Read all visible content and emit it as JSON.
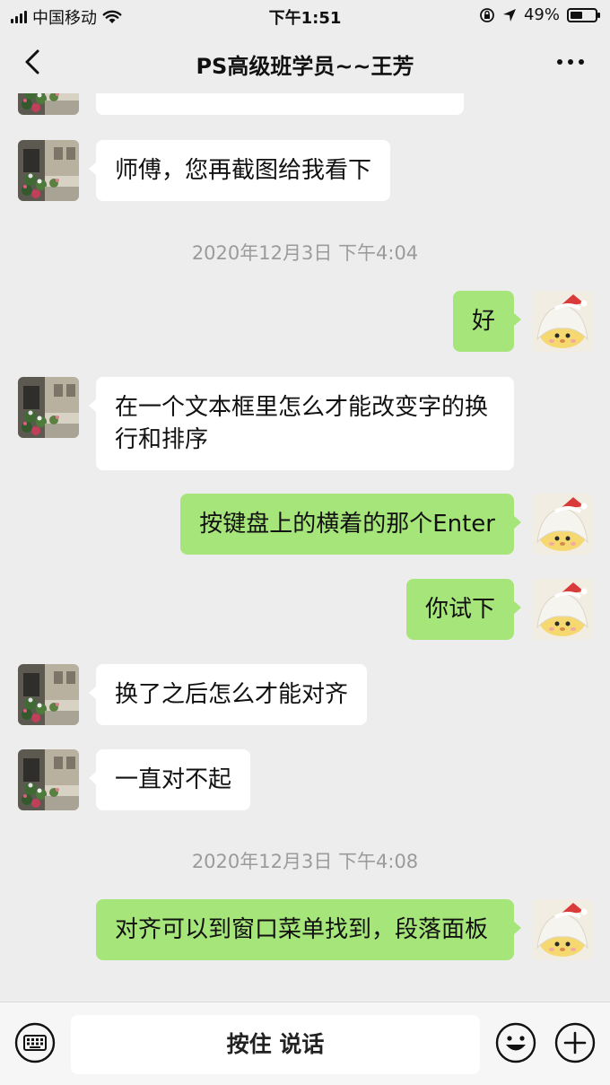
{
  "status_bar": {
    "carrier": "中国移动",
    "time": "下午1:51",
    "battery_text": "49%",
    "battery_level": 0.49
  },
  "nav": {
    "title": "PS高级班学员~~王芳"
  },
  "messages": [
    {
      "type": "in",
      "text": "师傅，您再截图给我看下"
    },
    {
      "type": "timestamp",
      "text": "2020年12月3日 下午4:04"
    },
    {
      "type": "out",
      "text": "好"
    },
    {
      "type": "in",
      "text": "在一个文本框里怎么才能改变字的换行和排序"
    },
    {
      "type": "out",
      "text": "按键盘上的横着的那个Enter"
    },
    {
      "type": "out",
      "text": "你试下"
    },
    {
      "type": "in",
      "text": "换了之后怎么才能对齐"
    },
    {
      "type": "in",
      "text": "一直对不起"
    },
    {
      "type": "timestamp",
      "text": "2020年12月3日 下午4:08"
    },
    {
      "type": "out",
      "text": "对齐可以到窗口菜单找到，段落面板"
    }
  ],
  "input_bar": {
    "hold_to_talk_label": "按住 说话",
    "left_icon": "keyboard-icon",
    "emoji_icon": "emoji-icon",
    "plus_icon": "plus-icon"
  },
  "colors": {
    "background": "#ededed",
    "incoming_bubble": "#ffffff",
    "outgoing_bubble": "#a6e57a",
    "timestamp_text": "#9b9b9b"
  }
}
